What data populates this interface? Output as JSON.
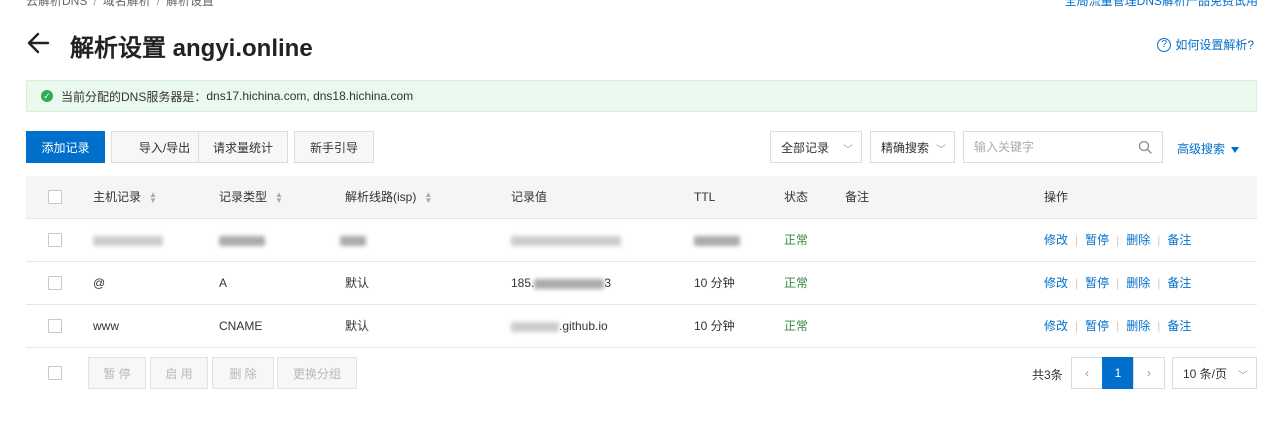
{
  "header": {
    "crumbs": [
      "云解析DNS",
      "域名解析",
      "解析设置"
    ],
    "top_right_link": "全局流量管理DNS解析产品免费试用",
    "title": "解析设置 angyi.online",
    "help_link": "如何设置解析?"
  },
  "notice": {
    "label": "当前分配的DNS服务器是：",
    "servers": "dns17.hichina.com, dns18.hichina.com"
  },
  "toolbar": {
    "add_record": "添加记录",
    "import_export": "导入/导出",
    "request_stats": "请求量统计",
    "beginner_guide": "新手引导",
    "record_filter": "全部记录",
    "search_mode": "精确搜索",
    "search_placeholder": "输入关键字",
    "advanced_search": "高级搜索"
  },
  "table": {
    "columns": {
      "host": "主机记录",
      "type": "记录类型",
      "line": "解析线路(isp)",
      "value": "记录值",
      "ttl": "TTL",
      "status": "状态",
      "remark": "备注",
      "actions": "操作"
    },
    "rows": [
      {
        "host": "",
        "type": "",
        "line": "",
        "value": "",
        "ttl": "",
        "status": "正常",
        "remark": ""
      },
      {
        "host": "@",
        "type": "A",
        "line": "默认",
        "value_prefix": "185.",
        "value_suffix": "3",
        "ttl": "10 分钟",
        "status": "正常",
        "remark": ""
      },
      {
        "host": "www",
        "type": "CNAME",
        "line": "默认",
        "value_suffix": ".github.io",
        "ttl": "10 分钟",
        "status": "正常",
        "remark": ""
      }
    ],
    "actions": {
      "edit": "修改",
      "pause": "暂停",
      "delete": "删除",
      "remark": "备注"
    }
  },
  "footer": {
    "pause": "暂 停",
    "enable": "启 用",
    "delete": "删 除",
    "change_group": "更换分组",
    "total": "共3条",
    "current_page": "1",
    "page_size": "10 条/页"
  },
  "colors": {
    "primary": "#0070cc",
    "status_ok": "#2e8b3d",
    "notice_bg": "#ebf8ee",
    "notice_icon": "#2fae4f"
  }
}
